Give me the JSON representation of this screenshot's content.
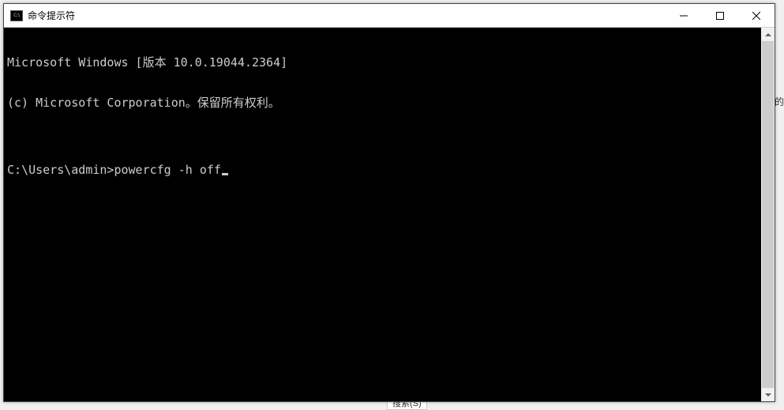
{
  "window": {
    "title": "命令提示符",
    "icon_glyph": "C:\\"
  },
  "terminal": {
    "line1": "Microsoft Windows [版本 10.0.19044.2364]",
    "line2": "(c) Microsoft Corporation。保留所有权利。",
    "blank": "",
    "prompt": "C:\\Users\\admin>",
    "command": "powercfg -h off"
  },
  "background": {
    "right_fragment": "的",
    "bottom_fragment": "搜索(S)"
  }
}
